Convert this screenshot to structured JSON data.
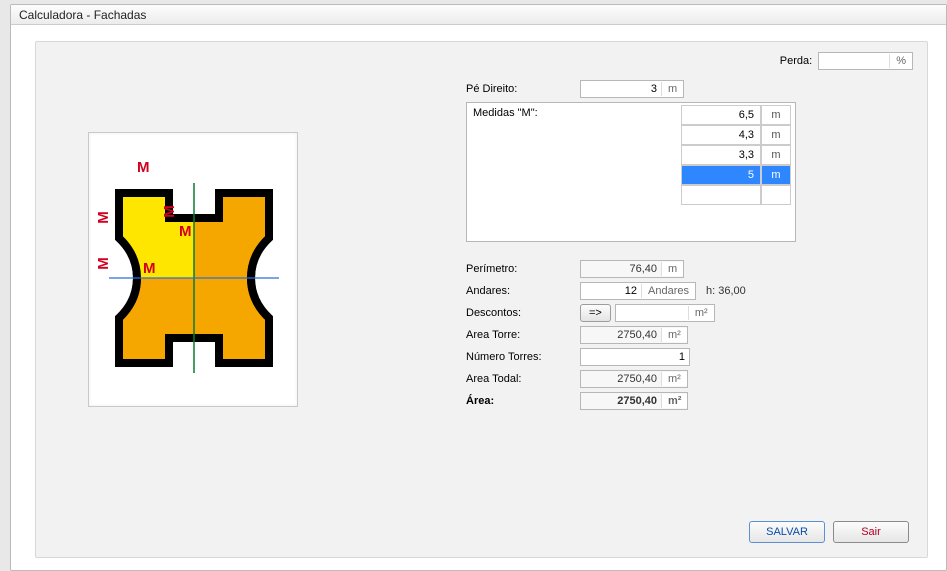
{
  "window": {
    "title": "Calculadora - Fachadas"
  },
  "perda": {
    "label": "Perda:",
    "value": "",
    "unit": "%"
  },
  "pe_direito": {
    "label": "Pé Direito:",
    "value": "3",
    "unit": "m"
  },
  "medidas": {
    "label": "Medidas \"M\":",
    "rows": [
      {
        "value": "6,5",
        "unit": "m",
        "selected": false
      },
      {
        "value": "4,3",
        "unit": "m",
        "selected": false
      },
      {
        "value": "3,3",
        "unit": "m",
        "selected": false
      },
      {
        "value": "5",
        "unit": "m",
        "selected": true
      },
      {
        "value": "",
        "unit": "",
        "selected": false
      }
    ]
  },
  "perimetro": {
    "label": "Perímetro:",
    "value": "76,40",
    "unit": "m"
  },
  "andares": {
    "label": "Andares:",
    "value": "12",
    "unit": "Andares",
    "extra": "h: 36,00"
  },
  "descontos": {
    "label": "Descontos:",
    "btn": "=>",
    "value": "",
    "unit": "m²"
  },
  "area_torre": {
    "label": "Area Torre:",
    "value": "2750,40",
    "unit": "m²"
  },
  "num_torres": {
    "label": "Número Torres:",
    "value": "1",
    "unit": ""
  },
  "area_todal": {
    "label": "Area Todal:",
    "value": "2750,40",
    "unit": "m²"
  },
  "area": {
    "label": "Área:",
    "value": "2750,40",
    "unit": "m²"
  },
  "diagram": {
    "m_labels": [
      "M",
      "M",
      "M",
      "M",
      "M"
    ]
  },
  "buttons": {
    "save": "SALVAR",
    "exit": "Sair"
  }
}
